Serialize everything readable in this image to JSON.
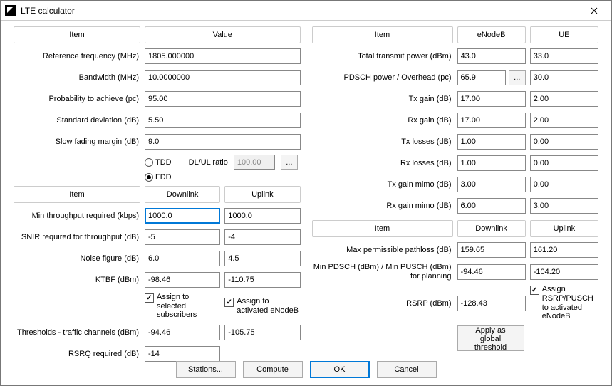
{
  "window": {
    "title": "LTE calculator"
  },
  "left": {
    "h_item": "Item",
    "h_value": "Value",
    "ref_freq_lbl": "Reference frequency (MHz)",
    "ref_freq": "1805.000000",
    "bandwidth_lbl": "Bandwidth (MHz)",
    "bandwidth": "10.0000000",
    "prob_lbl": "Probability to achieve (pc)",
    "prob": "95.00",
    "stddev_lbl": "Standard deviation (dB)",
    "stddev": "5.50",
    "slowfade_lbl": "Slow fading margin (dB)",
    "slowfade": "9.0",
    "tdd_lbl": "TDD",
    "fdd_lbl": "FDD",
    "dlul_lbl": "DL/UL ratio",
    "dlul": "100.00",
    "h_dl": "Downlink",
    "h_ul": "Uplink",
    "minthr_lbl": "Min throughput required (kbps)",
    "minthr_dl": "1000.0",
    "minthr_ul": "1000.0",
    "snir_lbl": "SNIR required for throughput (dB)",
    "snir_dl": "-5",
    "snir_ul": "-4",
    "nf_lbl": "Noise figure (dB)",
    "nf_dl": "6.0",
    "nf_ul": "4.5",
    "ktbf_lbl": "KTBF (dBm)",
    "ktbf_dl": "-98.46",
    "ktbf_ul": "-110.75",
    "assign_sub": "Assign to selected subscribers",
    "assign_enb": "Assign to activated eNodeB",
    "thr_traffic_lbl": "Thresholds - traffic channels (dBm)",
    "thr_traffic_dl": "-94.46",
    "thr_traffic_ul": "-105.75",
    "rsrq_lbl": "RSRQ required (dB)",
    "rsrq": "-14"
  },
  "right": {
    "h_item": "Item",
    "h_enb": "eNodeB",
    "h_ue": "UE",
    "ttp_lbl": "Total transmit power (dBm)",
    "ttp_enb": "43.0",
    "ttp_ue": "33.0",
    "pdsch_lbl": "PDSCH power / Overhead (pc)",
    "pdsch_enb": "65.9",
    "pdsch_ue": "30.0",
    "txgain_lbl": "Tx gain (dB)",
    "txgain_enb": "17.00",
    "txgain_ue": "2.00",
    "rxgain_lbl": "Rx gain (dB)",
    "rxgain_enb": "17.00",
    "rxgain_ue": "2.00",
    "txloss_lbl": "Tx losses (dB)",
    "txloss_enb": "1.00",
    "txloss_ue": "0.00",
    "rxloss_lbl": "Rx losses (dB)",
    "rxloss_enb": "1.00",
    "rxloss_ue": "0.00",
    "txmimo_lbl": "Tx gain mimo (dB)",
    "txmimo_enb": "3.00",
    "txmimo_ue": "0.00",
    "rxmimo_lbl": "Rx gain mimo (dB)",
    "rxmimo_enb": "6.00",
    "rxmimo_ue": "3.00",
    "h2_item": "Item",
    "h2_dl": "Downlink",
    "h2_ul": "Uplink",
    "maxpl_lbl": "Max permissible pathloss (dB)",
    "maxpl_dl": "159.65",
    "maxpl_ul": "161.20",
    "minp_lbl": "Min PDSCH (dBm) / Min PUSCH (dBm) for planning",
    "minp_dl": "-94.46",
    "minp_ul": "-104.20",
    "rsrp_lbl": "RSRP (dBm)",
    "rsrp_dl": "-128.43",
    "assign_rsrp": "Assign RSRP/PUSCH to activated eNodeB",
    "apply_global": "Apply as global threshold"
  },
  "footer": {
    "stations": "Stations...",
    "compute": "Compute",
    "ok": "OK",
    "cancel": "Cancel"
  },
  "ellipsis": "..."
}
